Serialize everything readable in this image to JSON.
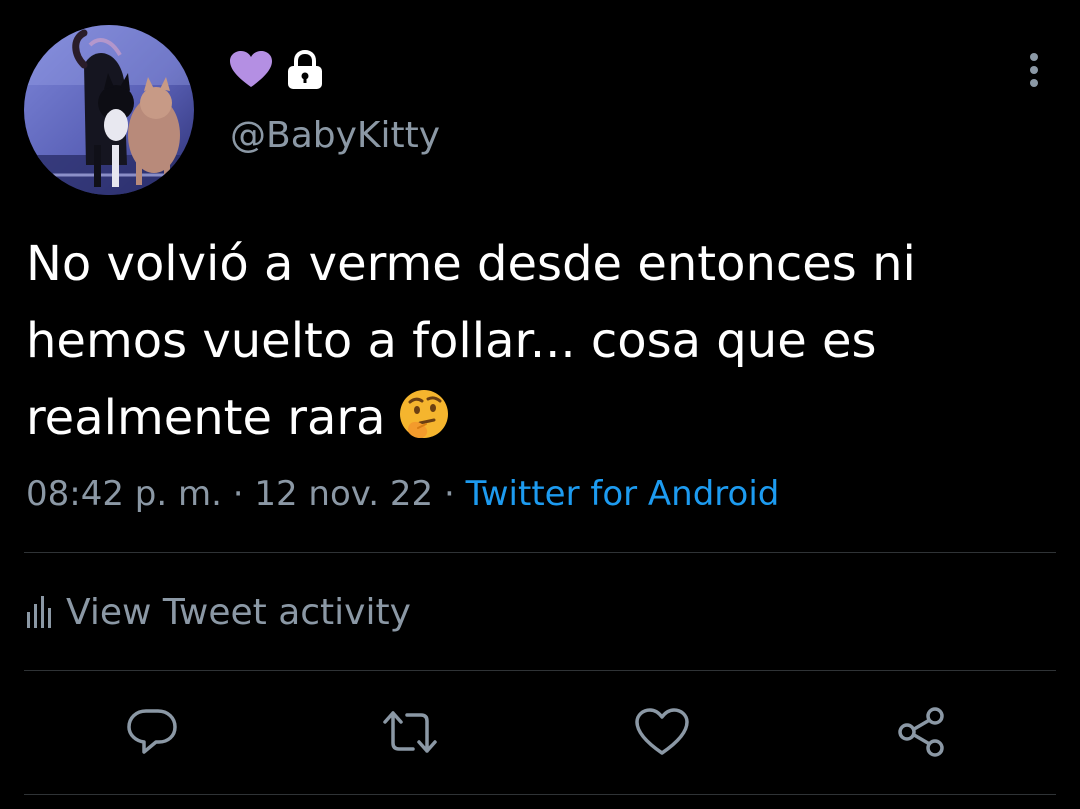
{
  "author": {
    "handle": "@BabyKitty",
    "name_badges": [
      "purple-heart-icon",
      "lock-icon"
    ]
  },
  "tweet": {
    "lines": [
      "No volvió a verme desde entonces ni",
      "hemos vuelto a follar... cosa que es",
      "realmente rara"
    ],
    "emoji": "thinking-face-icon"
  },
  "meta": {
    "time": "08:42 p. m.",
    "separator": " · ",
    "date": "12 nov. 22",
    "source": "Twitter for Android"
  },
  "activity": {
    "label": "View Tweet activity",
    "icon": "bar-chart-icon"
  },
  "actions": [
    "reply-icon",
    "retweet-icon",
    "like-icon",
    "share-icon"
  ],
  "colors": {
    "background": "#000000",
    "text": "#ffffff",
    "secondary_text": "#8b98a5",
    "link": "#1d9bf0",
    "heart": "#b48fe3",
    "divider": "#2f3336"
  }
}
